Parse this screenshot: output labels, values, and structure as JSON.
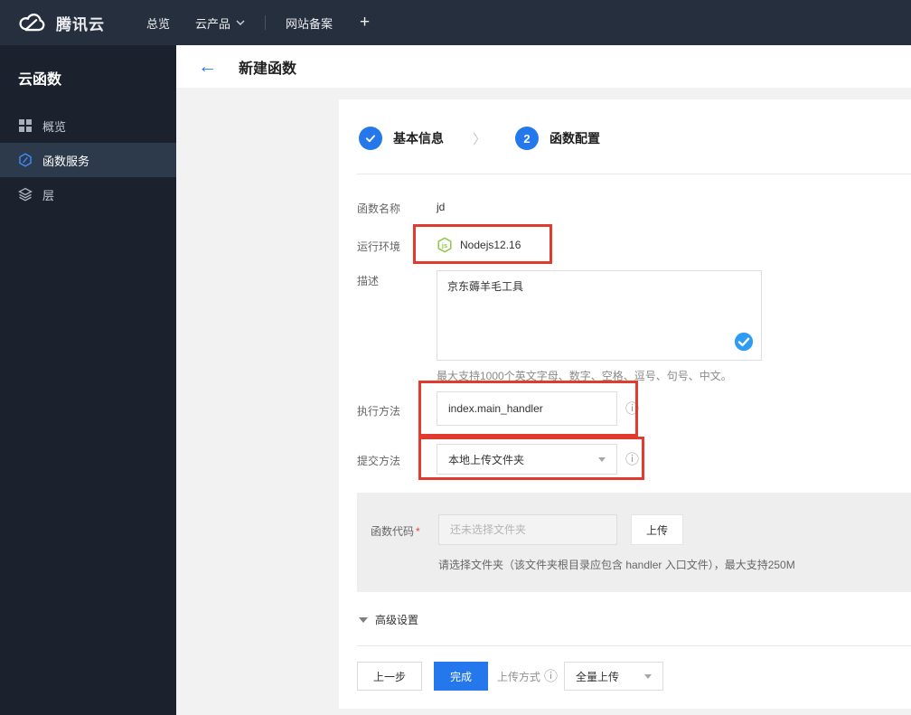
{
  "colors": {
    "accent": "#2478ec",
    "annotation_red": "#e23a2e",
    "node_green": "#8cc84b",
    "topnav_bg": "#262f3e",
    "sidebar_bg": "#1b222d",
    "sidebar_selected_bg": "#2d3a4b"
  },
  "icons": {
    "brand": "tencent-cloud-logo",
    "nav_caret": "chevron-down-icon",
    "overview": "grid-icon",
    "function_service": "function-hexagon-icon",
    "layers": "layers-icon",
    "back": "back-arrow-icon",
    "step_done": "check-circle-icon",
    "runtime": "nodejs-icon",
    "desc_valid": "check-circle-icon",
    "info": "info-icon",
    "select_caret": "caret-down-icon",
    "advanced_caret": "triangle-down-icon"
  },
  "topnav": {
    "brand": "腾讯云",
    "overview": "总览",
    "cloud_products": "云产品",
    "icp": "网站备案",
    "plus": "+"
  },
  "sidebar": {
    "title": "云函数",
    "items": [
      {
        "label": "概览",
        "selected": false
      },
      {
        "label": "函数服务",
        "selected": true
      },
      {
        "label": "层",
        "selected": false
      }
    ]
  },
  "header": {
    "title": "新建函数"
  },
  "steps": {
    "step1_label": "基本信息",
    "step2_num": "2",
    "step2_label": "函数配置"
  },
  "form": {
    "name_label": "函数名称",
    "name_value": "jd",
    "runtime_label": "运行环境",
    "runtime_value": "Nodejs12.16",
    "desc_label": "描述",
    "desc_value": "京东薅羊毛工具",
    "desc_helper": "最大支持1000个英文字母、数字、空格、逗号、句号、中文。",
    "handler_label": "执行方法",
    "handler_value": "index.main_handler",
    "submit_label": "提交方法",
    "submit_value": "本地上传文件夹",
    "code_label": "函数代码",
    "code_required": "*",
    "code_placeholder": "还未选择文件夹",
    "upload_button": "上传",
    "code_helper": "请选择文件夹（该文件夹根目录应包含 handler 入口文件），最大支持250M",
    "advanced_label": "高级设置"
  },
  "footer": {
    "prev": "上一步",
    "finish": "完成",
    "upload_mode_label": "上传方式",
    "upload_mode_value": "全量上传"
  }
}
